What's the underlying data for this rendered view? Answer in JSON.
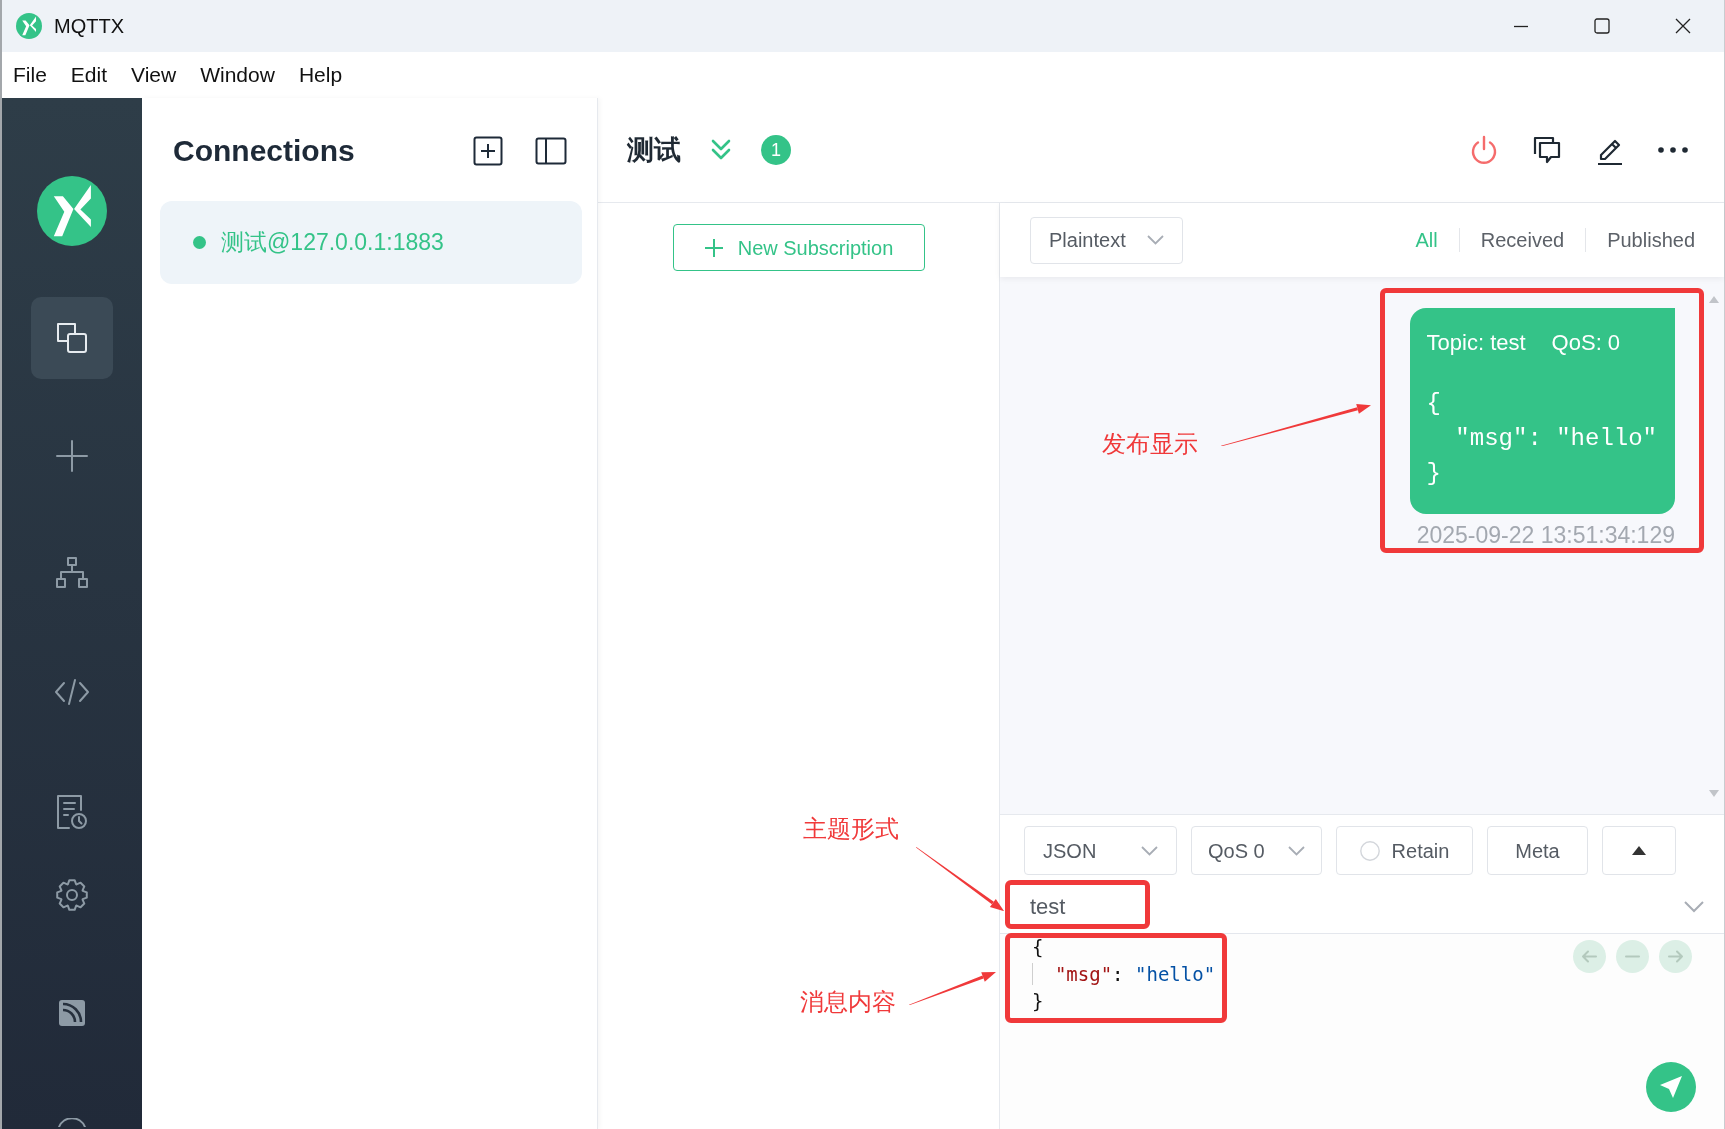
{
  "window": {
    "title": "MQTTX"
  },
  "menu": [
    "File",
    "Edit",
    "View",
    "Window",
    "Help"
  ],
  "sidebar": {
    "items": [
      {
        "kind": "windows",
        "selected": true
      },
      {
        "kind": "plus",
        "selected": false
      },
      {
        "kind": "tree",
        "selected": false
      },
      {
        "kind": "code",
        "selected": false
      },
      {
        "kind": "document",
        "selected": false
      },
      {
        "kind": "gear",
        "selected": false
      },
      {
        "kind": "signal",
        "selected": false
      },
      {
        "kind": "circle",
        "selected": false
      }
    ]
  },
  "connections": {
    "title": "Connections",
    "items": [
      {
        "label": "测试@127.0.0.1:1883",
        "selected": true,
        "online": true
      }
    ]
  },
  "connection": {
    "title": "测试",
    "badge": "1"
  },
  "subscriptions": {
    "add_button": "New Subscription"
  },
  "messages": {
    "format": "Plaintext",
    "filters": [
      {
        "label": "All",
        "selected": true
      },
      {
        "label": "Received",
        "selected": false
      },
      {
        "label": "Published",
        "selected": false
      }
    ],
    "items": [
      {
        "kind": "published",
        "topic": "Topic: test",
        "qos": "QoS: 0",
        "payload": [
          "{",
          "  \"msg\": \"hello\"",
          "}"
        ],
        "time": "2025-09-22 13:51:34:129"
      }
    ]
  },
  "publish": {
    "format": "JSON",
    "qos": "QoS 0",
    "retain": {
      "label": "Retain",
      "checked": false
    },
    "meta": "Meta",
    "topic": "test",
    "payload": [
      "{",
      "  \"msg\": \"hello\"",
      "}"
    ]
  },
  "annotations": [
    {
      "kind": "message",
      "text": "发布显示"
    },
    {
      "kind": "topic",
      "text": "主题形式"
    },
    {
      "kind": "payload",
      "text": "消息内容"
    }
  ]
}
